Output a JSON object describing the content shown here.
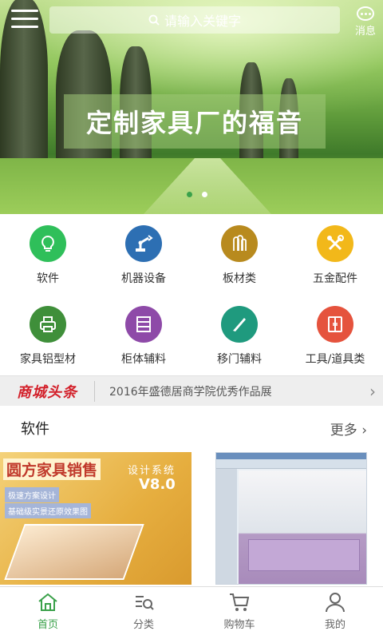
{
  "search": {
    "placeholder": "请输入关键字"
  },
  "header": {
    "message_label": "消息"
  },
  "banner": {
    "title": "定制家具厂的福音",
    "slides": 2,
    "active_slide": 1,
    "dot_active_color": "#3aa14a",
    "dot_color": "#ffffff"
  },
  "categories": [
    {
      "label": "软件",
      "icon": "lightbulb-icon",
      "color": "#2fbf5a"
    },
    {
      "label": "机器设备",
      "icon": "robot-arm-icon",
      "color": "#2d6fb3"
    },
    {
      "label": "板材类",
      "icon": "wood-icon",
      "color": "#b88a1e"
    },
    {
      "label": "五金配件",
      "icon": "tools-icon",
      "color": "#f2b81a"
    },
    {
      "label": "家具铝型材",
      "icon": "printer-icon",
      "color": "#3f8f3a"
    },
    {
      "label": "柜体辅料",
      "icon": "cabinet-icon",
      "color": "#8e4aa8"
    },
    {
      "label": "移门辅料",
      "icon": "knife-icon",
      "color": "#1f9a7e"
    },
    {
      "label": "工具/道具类",
      "icon": "door-icon",
      "color": "#e5533d"
    }
  ],
  "news": {
    "logo": "商城头条",
    "headline": "2016年盛德居商学院优秀作品展"
  },
  "section": {
    "title": "软件",
    "more": "更多"
  },
  "products": [
    {
      "title": "圆方家具销售",
      "subtitle": "设计系统",
      "version": "V8.0",
      "tag1": "极速方案设计",
      "tag2": "基础级实景还原效果图"
    },
    {
      "name": "kitchen-design-software"
    }
  ],
  "tabs": [
    {
      "label": "首页",
      "icon": "home-icon",
      "active": true
    },
    {
      "label": "分类",
      "icon": "category-icon",
      "active": false
    },
    {
      "label": "购物车",
      "icon": "cart-icon",
      "active": false
    },
    {
      "label": "我的",
      "icon": "user-icon",
      "active": false
    }
  ],
  "colors": {
    "accent": "#3aa14a",
    "brand_red": "#d3202a"
  }
}
